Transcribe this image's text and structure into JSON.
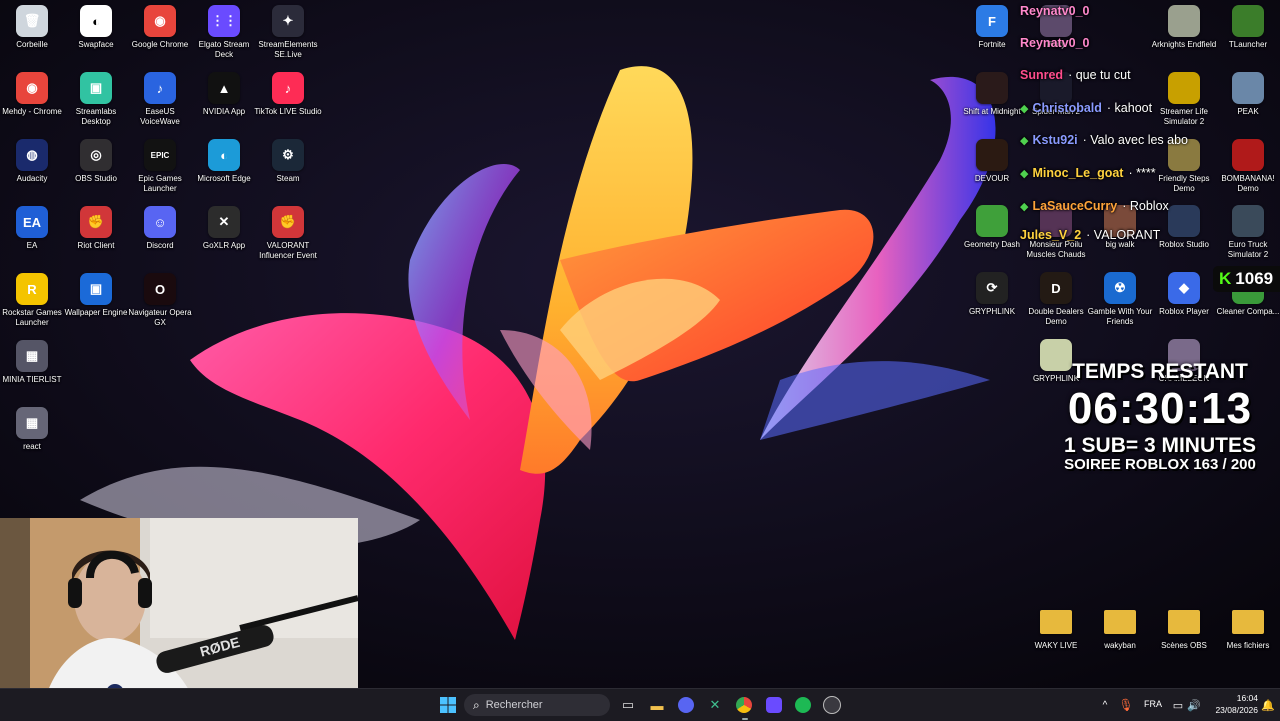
{
  "desktop_left": [
    {
      "label": "Corbeille",
      "color": "#cfd6dd",
      "glyph": "🗑"
    },
    {
      "label": "Swapface",
      "color": "#ffffff",
      "glyph": "◐"
    },
    {
      "label": "Google Chrome",
      "color": "#e8453c",
      "glyph": "◉"
    },
    {
      "label": "Elgato Stream Deck",
      "color": "#6a4bff",
      "glyph": "⋮⋮"
    },
    {
      "label": "StreamElements SE.Live",
      "color": "#2b2b3a",
      "glyph": "✦"
    },
    {
      "label": "Mehdy - Chrome",
      "color": "#e8453c",
      "glyph": "◉"
    },
    {
      "label": "Streamlabs Desktop",
      "color": "#31c3a2",
      "glyph": "▣"
    },
    {
      "label": "EaseUS VoiceWave",
      "color": "#2a64e0",
      "glyph": "♪"
    },
    {
      "label": "NVIDIA App",
      "color": "#111111",
      "glyph": "▲"
    },
    {
      "label": "TikTok LIVE Studio",
      "color": "#fe2c55",
      "glyph": "♪"
    },
    {
      "label": "Audacity",
      "color": "#1a2a6c",
      "glyph": "◍"
    },
    {
      "label": "OBS Studio",
      "color": "#302e31",
      "glyph": "◎"
    },
    {
      "label": "Epic Games Launcher",
      "color": "#121212",
      "glyph": "EPIC"
    },
    {
      "label": "Microsoft Edge",
      "color": "#1c9bd8",
      "glyph": "◐"
    },
    {
      "label": "Steam",
      "color": "#1b2838",
      "glyph": "⚙"
    },
    {
      "label": "EA",
      "color": "#1f5fd6",
      "glyph": "EA"
    },
    {
      "label": "Riot Client",
      "color": "#d13639",
      "glyph": "✊"
    },
    {
      "label": "Discord",
      "color": "#5865f2",
      "glyph": "☺"
    },
    {
      "label": "GoXLR App",
      "color": "#2c2c2c",
      "glyph": "✕"
    },
    {
      "label": "VALORANT Influencer Event",
      "color": "#d13639",
      "glyph": "✊"
    },
    {
      "label": "Rockstar Games Launcher",
      "color": "#f4c400",
      "glyph": "R"
    },
    {
      "label": "Wallpaper Engine",
      "color": "#1b6ad8",
      "glyph": "▣"
    },
    {
      "label": "Navigateur Opera GX",
      "color": "#1a0a0e",
      "glyph": "O"
    },
    {
      "label": "MINIA TIERLIST",
      "color": "#555566",
      "glyph": "▦"
    },
    {
      "label": "react",
      "color": "#666677",
      "glyph": "▦"
    }
  ],
  "desktop_right": [
    {
      "label": "Fortnite",
      "color": "#2c7be5",
      "glyph": "F"
    },
    {
      "label": "Party",
      "color": "#5c4a6b",
      "glyph": ""
    },
    {
      "label": "Arknights Endfield",
      "color": "#9aa08e",
      "glyph": ""
    },
    {
      "label": "TLauncher",
      "color": "#3b7d2a",
      "glyph": ""
    },
    {
      "label": "Shift at Midnight",
      "color": "#2a1a1a",
      "glyph": ""
    },
    {
      "label": "Spider-Man 2",
      "color": "#1a1a2a",
      "glyph": ""
    },
    {
      "label": "Streamer Life Simulator 2",
      "color": "#c8a000",
      "glyph": ""
    },
    {
      "label": "PEAK",
      "color": "#6a87a8",
      "glyph": ""
    },
    {
      "label": "DEVOUR",
      "color": "#2b1a12",
      "glyph": ""
    },
    {
      "label": "Friendly Steps Demo",
      "color": "#8a7a40",
      "glyph": ""
    },
    {
      "label": "BOMBANANA! Demo",
      "color": "#b01a1a",
      "glyph": ""
    },
    {
      "label": "Geometry Dash",
      "color": "#3fa03a",
      "glyph": ""
    },
    {
      "label": "Monsieur Poilu Muscles Chauds",
      "color": "#553355",
      "glyph": ""
    },
    {
      "label": "big walk",
      "color": "#7a4a3a",
      "glyph": ""
    },
    {
      "label": "Roblox Studio",
      "color": "#2a3a5a",
      "glyph": ""
    },
    {
      "label": "Euro Truck Simulator 2",
      "color": "#3a4a5a",
      "glyph": ""
    },
    {
      "label": "GRYPHLINK",
      "color": "#222222",
      "glyph": "⟳"
    },
    {
      "label": "Double Dealers Demo",
      "color": "#231a14",
      "glyph": "D"
    },
    {
      "label": "Gamble With Your Friends",
      "color": "#1a6ad0",
      "glyph": "☢"
    },
    {
      "label": "Roblox Player",
      "color": "#3a6ae8",
      "glyph": "◆"
    },
    {
      "label": "Cleaner Compa...",
      "color": "#3a9a3a",
      "glyph": ""
    },
    {
      "label": "GRYPHLINK",
      "color": "#c8d0a8",
      "glyph": ""
    },
    {
      "label": "CHAMELEON",
      "color": "#7a6a8a",
      "glyph": ""
    },
    {
      "label": "WAKY LIVE",
      "color": "#e7b93d",
      "glyph": ""
    },
    {
      "label": "wakyban",
      "color": "#e7b93d",
      "glyph": ""
    },
    {
      "label": "Scènes OBS",
      "color": "#e7b93d",
      "glyph": ""
    },
    {
      "label": "Mes fichiers",
      "color": "#e7b93d",
      "glyph": ""
    }
  ],
  "chat": [
    {
      "user": "Reynatv0_0",
      "msg": "",
      "color": "#ff88cc",
      "diamond": false
    },
    {
      "user": "Reynatv0_0",
      "msg": "",
      "color": "#ff88cc",
      "diamond": false
    },
    {
      "user": "Sunred",
      "msg": "· que tu cut",
      "color": "#ff4d8d",
      "diamond": false
    },
    {
      "user": "Christobald",
      "msg": "· kahoot",
      "color": "#8a9aff",
      "diamond": true
    },
    {
      "user": "Kstu92i",
      "msg": "· Valo avec les abo",
      "color": "#8a9aff",
      "diamond": true
    },
    {
      "user": "Minoc_Le_goat",
      "msg": "· ****",
      "color": "#ffd23f",
      "diamond": true
    },
    {
      "user": "LaSauceCurry",
      "msg": "· Roblox",
      "color": "#ffa43a",
      "diamond": true
    },
    {
      "user": "Jules_V_2",
      "msg": "· VALORANT",
      "color": "#ffd23f",
      "diamond": false
    }
  ],
  "kick_badge": {
    "letter": "K",
    "count": "1069"
  },
  "timer": {
    "label": "TEMPS RESTANT",
    "value": "06:30:13",
    "rule": "1 SUB= 3 MINUTES",
    "goal": "SOIREE ROBLOX 163 / 200"
  },
  "taskbar": {
    "search_placeholder": "Rechercher",
    "lang": "FRA",
    "time": "16:04",
    "date": "23/08/2026"
  },
  "colors": {
    "taskbar": "#1c1b22",
    "accent": "#2b7de9"
  }
}
